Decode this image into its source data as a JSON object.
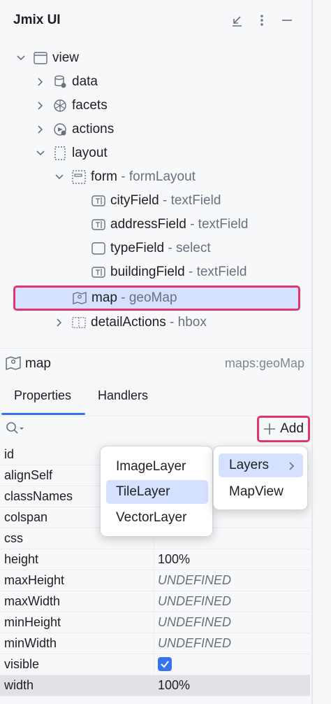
{
  "panel": {
    "title": "Jmix UI"
  },
  "tree": {
    "items": [
      {
        "label": "view",
        "type": ""
      },
      {
        "label": "data",
        "type": ""
      },
      {
        "label": "facets",
        "type": ""
      },
      {
        "label": "actions",
        "type": ""
      },
      {
        "label": "layout",
        "type": ""
      },
      {
        "label": "form",
        "type": "- formLayout"
      },
      {
        "label": "cityField",
        "type": "- textField"
      },
      {
        "label": "addressField",
        "type": "- textField"
      },
      {
        "label": "typeField",
        "type": "- select"
      },
      {
        "label": "buildingField",
        "type": "- textField"
      },
      {
        "label": "map",
        "type": "- geoMap"
      },
      {
        "label": "detailActions",
        "type": "- hbox"
      }
    ]
  },
  "component": {
    "name": "map",
    "type": "maps:geoMap"
  },
  "tabs": {
    "properties": "Properties",
    "handlers": "Handlers"
  },
  "toolbar": {
    "add_label": "Add"
  },
  "properties": [
    {
      "name": "id",
      "value": ""
    },
    {
      "name": "alignSelf",
      "value": ""
    },
    {
      "name": "classNames",
      "value": ""
    },
    {
      "name": "colspan",
      "value": ""
    },
    {
      "name": "css",
      "value": ""
    },
    {
      "name": "height",
      "value": "100%"
    },
    {
      "name": "maxHeight",
      "value": "UNDEFINED"
    },
    {
      "name": "maxWidth",
      "value": "UNDEFINED"
    },
    {
      "name": "minHeight",
      "value": "UNDEFINED"
    },
    {
      "name": "minWidth",
      "value": "UNDEFINED"
    },
    {
      "name": "visible",
      "value": ""
    },
    {
      "name": "width",
      "value": "100%"
    }
  ],
  "add_menu": {
    "items": [
      "ImageLayer",
      "TileLayer",
      "VectorLayer"
    ],
    "submenu": [
      "Layers",
      "MapView"
    ]
  },
  "colors": {
    "accent": "#3574f0",
    "highlight": "#e0386e",
    "selection": "#d5e1ff"
  }
}
